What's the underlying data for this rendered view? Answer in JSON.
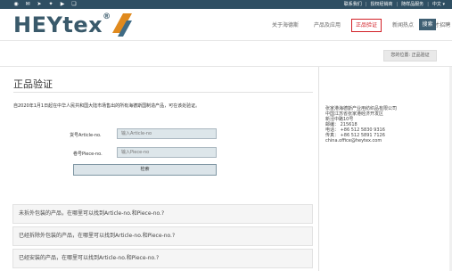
{
  "topbar": {
    "social_icons": [
      "rss-icon",
      "mail-icon",
      "telegram-icon",
      "twitter-icon",
      "youtube-icon",
      "wechat-icon"
    ],
    "social_glyphs": [
      "◉",
      "✉",
      "➤",
      "✦",
      "▶",
      "❏"
    ],
    "links": [
      "联系我们",
      "授权经销商",
      "随样品服务",
      "中文"
    ],
    "lang_arrow": "▾"
  },
  "brand": {
    "name": "HEYtex",
    "reg": "®"
  },
  "nav": {
    "items": [
      "关于海德斯",
      "产品及应用",
      "正品验证",
      "新闻热点",
      "人才招聘"
    ],
    "active_index": 2,
    "search_label": "搜索"
  },
  "breadcrumb": "您的位置: 正品验证",
  "page": {
    "title": "正品验证",
    "notice": "自2020年1月1日起在中华人民共和国大陆市场售出的所有海德斯国制造产品，可在该处验证。",
    "article_label": "货号Article-no.",
    "article_placeholder": "输入Article-no",
    "piece_label": "卷号Piece-no.",
    "piece_placeholder": "输入Piece-no",
    "check_label": "检索"
  },
  "faq": [
    "未拆外包装的产品，在哪里可以找到Article-no.和Piece-no.?",
    "已经拆除外包装的产品，在哪里可以找到Article-no.和Piece-no.?",
    "已经安装的产品，在哪里可以找到Article-no.和Piece-no.?"
  ],
  "contact": {
    "lines": [
      "张家港海德斯产业用纺织品有限公司",
      "中国江苏省张家港经济开发区",
      "新泾中路10号",
      "邮编： 215618",
      "电话： +86 512 5830 9316",
      "传真： +86 512 5891 7126",
      "china.office@heytex.com"
    ]
  }
}
